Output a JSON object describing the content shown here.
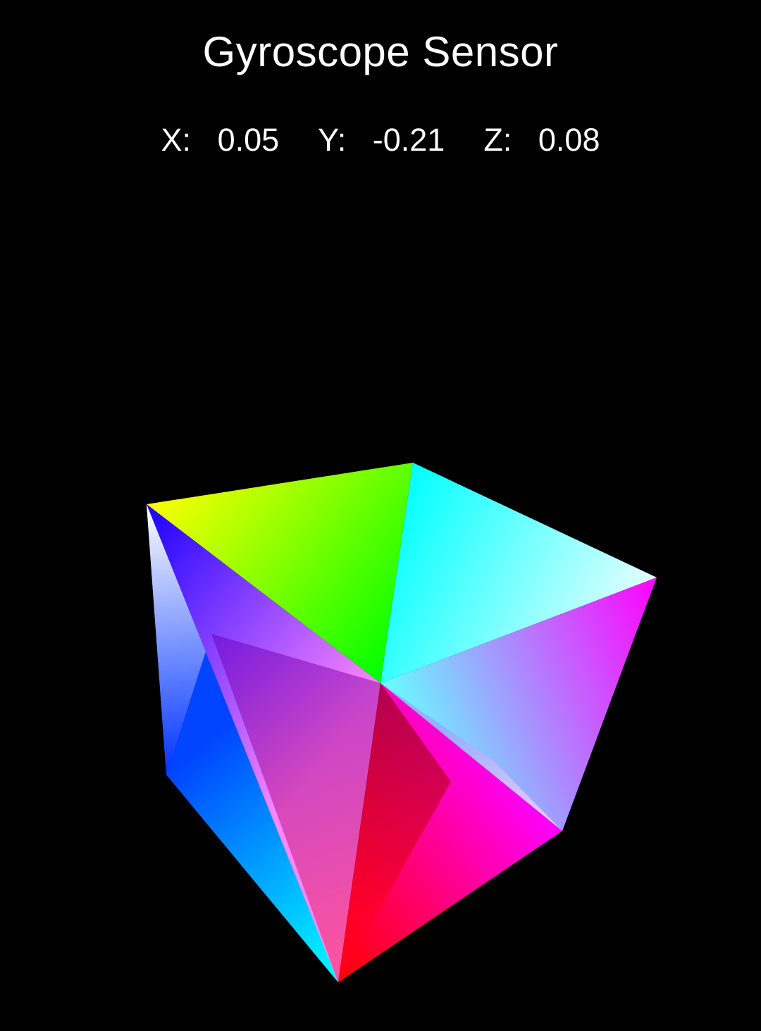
{
  "screen": {
    "title": "Gyroscope Sensor",
    "background": "#000000",
    "text_color": "#ffffff"
  },
  "readings": {
    "x_label": "X:",
    "x_value": "0.05",
    "y_label": "Y:",
    "y_value": "-0.21",
    "z_label": "Z:",
    "z_value": "0.08"
  },
  "cube": {
    "type": "rgb-color-cube",
    "vertex_colors": {
      "top_left": "#ffff00",
      "top_back": "#00ffff",
      "right": "#ffffff",
      "front_center": "#00ff00",
      "left_far": "#ffffff",
      "left_blue": "#0000ff",
      "bottom": "#ff0000",
      "right_lower": "#ff00ff"
    }
  }
}
